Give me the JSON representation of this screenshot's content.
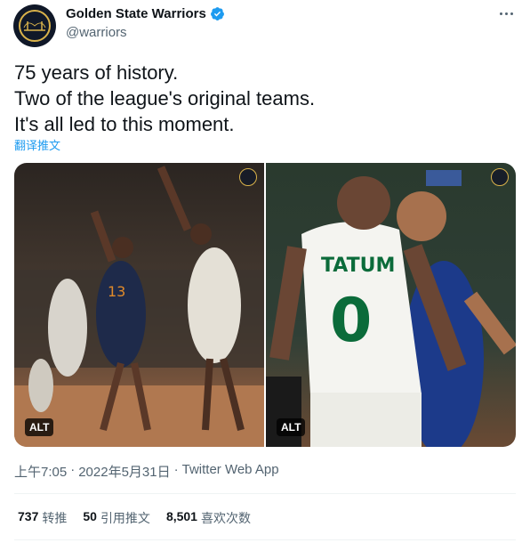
{
  "header": {
    "display_name": "Golden State Warriors",
    "handle": "@warriors",
    "verified_icon": "verified-badge-icon",
    "more_icon": "more-options-icon"
  },
  "tweet": {
    "lines": [
      "75 years of history.",
      "Two of the league's original teams.",
      "It's all led to this moment."
    ],
    "translate_label": "翻译推文"
  },
  "media": {
    "photos": [
      {
        "alt_label": "ALT",
        "description_icon": "warriors-logo-icon"
      },
      {
        "alt_label": "ALT",
        "description_icon": "warriors-logo-icon"
      }
    ]
  },
  "meta": {
    "time": "上午7:05",
    "separator": "·",
    "date": "2022年5月31日",
    "separator2": "·",
    "source": "Twitter Web App"
  },
  "stats": {
    "retweets_num": "737",
    "retweets_label": "转推",
    "quotes_num": "50",
    "quotes_label": "引用推文",
    "likes_num": "8,501",
    "likes_label": "喜欢次数"
  },
  "colors": {
    "link": "#1d9bf0",
    "text": "#0f1419",
    "muted": "#536471",
    "verified": "#1d9bf0",
    "brand_gold": "#d9b24a"
  }
}
